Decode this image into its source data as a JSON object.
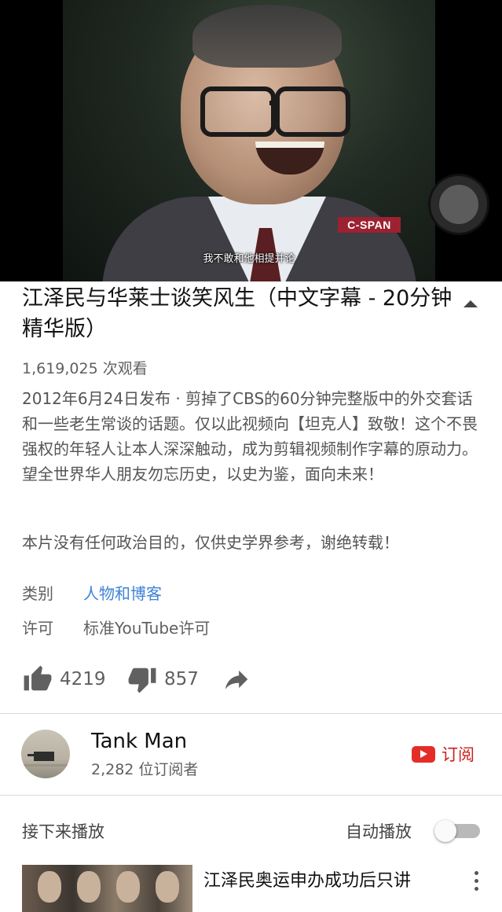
{
  "video": {
    "subtitle": "我不敢和他相提并论",
    "logo_text": "C-SPAN"
  },
  "info": {
    "title": "江泽民与华莱士谈笑风生（中文字幕 - 20分钟精华版）",
    "views": "1,619,025 次观看",
    "description": "2012年6月24日发布 · 剪掉了CBS的60分钟完整版中的外交套话和一些老生常谈的话题。仅以此视频向【坦克人】致敬！这个不畏强权的年轻人让本人深深触动，成为剪辑视频制作字幕的原动力。望全世界华人朋友勿忘历史，以史为鉴，面向未来！",
    "disclaimer": "本片没有任何政治目的，仅供史学界参考，谢绝转载！",
    "category_label": "类别",
    "category_value": "人物和博客",
    "license_label": "许可",
    "license_value": "标准YouTube许可"
  },
  "actions": {
    "likes": "4219",
    "dislikes": "857"
  },
  "channel": {
    "name": "Tank Man",
    "subscribers": "2,282 位订阅者",
    "subscribe_label": "订阅"
  },
  "up_next": {
    "label": "接下来播放",
    "autoplay_label": "自动播放",
    "autoplay_on": false,
    "items": [
      {
        "title": "江泽民奥运申办成功后只讲"
      }
    ]
  },
  "colors": {
    "link": "#3e83d6",
    "subscribe": "#cc1f1a",
    "youtube_red": "#e52d27"
  }
}
